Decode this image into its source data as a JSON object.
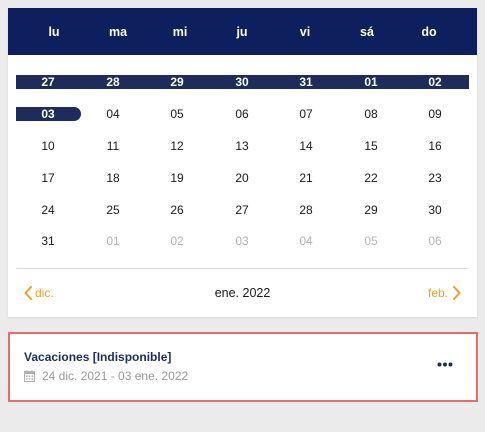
{
  "calendar": {
    "weekdays": [
      "lu",
      "ma",
      "mi",
      "ju",
      "vi",
      "sá",
      "do"
    ],
    "weeks": [
      [
        "27",
        "28",
        "29",
        "30",
        "31",
        "01",
        "02"
      ],
      [
        "03",
        "04",
        "05",
        "06",
        "07",
        "08",
        "09"
      ],
      [
        "10",
        "11",
        "12",
        "13",
        "14",
        "15",
        "16"
      ],
      [
        "17",
        "18",
        "19",
        "20",
        "21",
        "22",
        "23"
      ],
      [
        "24",
        "25",
        "26",
        "27",
        "28",
        "29",
        "30"
      ],
      [
        "31",
        "01",
        "02",
        "03",
        "04",
        "05",
        "06"
      ]
    ],
    "prev_label": "dic.",
    "next_label": "feb.",
    "month_label": "ene. 2022",
    "accent_color": "#1e2c5c",
    "header_color": "#0d1f5c",
    "nav_color": "#f0a020"
  },
  "event": {
    "title": "Vacaciones [Indisponible]",
    "dates": "24 dic. 2021 - 03 ene. 2022",
    "icon": "calendar-icon",
    "border_color": "#e96b6b"
  }
}
